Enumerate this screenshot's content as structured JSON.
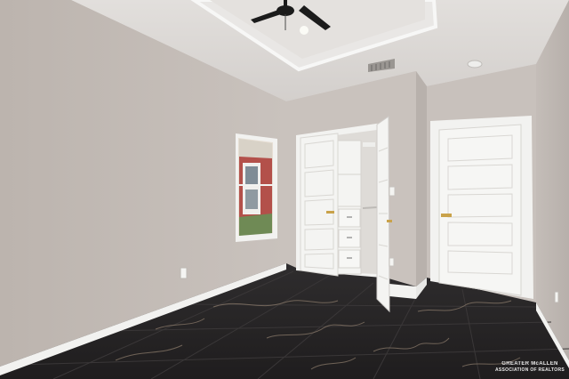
{
  "photo": {
    "subject": "empty-bedroom-interior",
    "watermark": {
      "line1": "GREATER McALLEN",
      "line2": "ASSOCIATION OF REALTORS"
    },
    "colors": {
      "wall": "#c6bfba",
      "wall_shadow": "#b3aca7",
      "ceiling": "#dedbd8",
      "trim": "#f2f2f0",
      "door": "#f4f4f2",
      "floor": "#2a2829",
      "floor_vein": "#8a7a6a",
      "brick": "#b3504a",
      "fan": "#1b1b1b"
    }
  }
}
